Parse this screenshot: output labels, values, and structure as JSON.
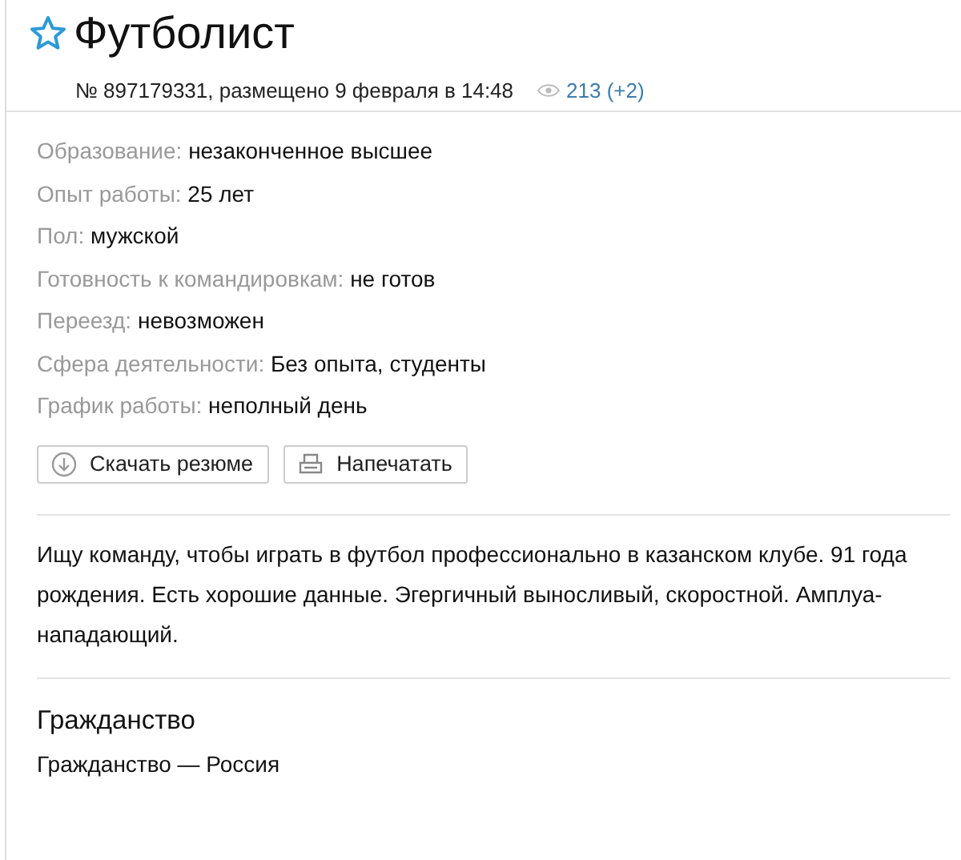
{
  "title": "Футболист",
  "meta": {
    "number": "№ 897179331, размещено 9 февраля в 14:48",
    "views": "213 (+2)"
  },
  "details": [
    {
      "label": "Образование:",
      "value": "незаконченное высшее"
    },
    {
      "label": "Опыт работы:",
      "value": "25 лет"
    },
    {
      "label": "Пол:",
      "value": "мужской"
    },
    {
      "label": "Готовность к командировкам:",
      "value": "не готов"
    },
    {
      "label": "Переезд:",
      "value": "невозможен"
    },
    {
      "label": "Сфера деятельности:",
      "value": "Без опыта, студенты"
    },
    {
      "label": "График работы:",
      "value": "неполный день"
    }
  ],
  "buttons": [
    {
      "kind": "download",
      "label": "Скачать резюме"
    },
    {
      "kind": "print",
      "label": "Напечатать"
    }
  ],
  "description": "Ищу команду, чтобы играть в футбол профессионально в казанском клубе. 91 года рождения. Есть хорошие данные. Эгергичный выносливый, скоростной. Амплуа-нападающий.",
  "citizenship": {
    "heading": "Гражданство",
    "text": "Гражданство — Россия"
  }
}
